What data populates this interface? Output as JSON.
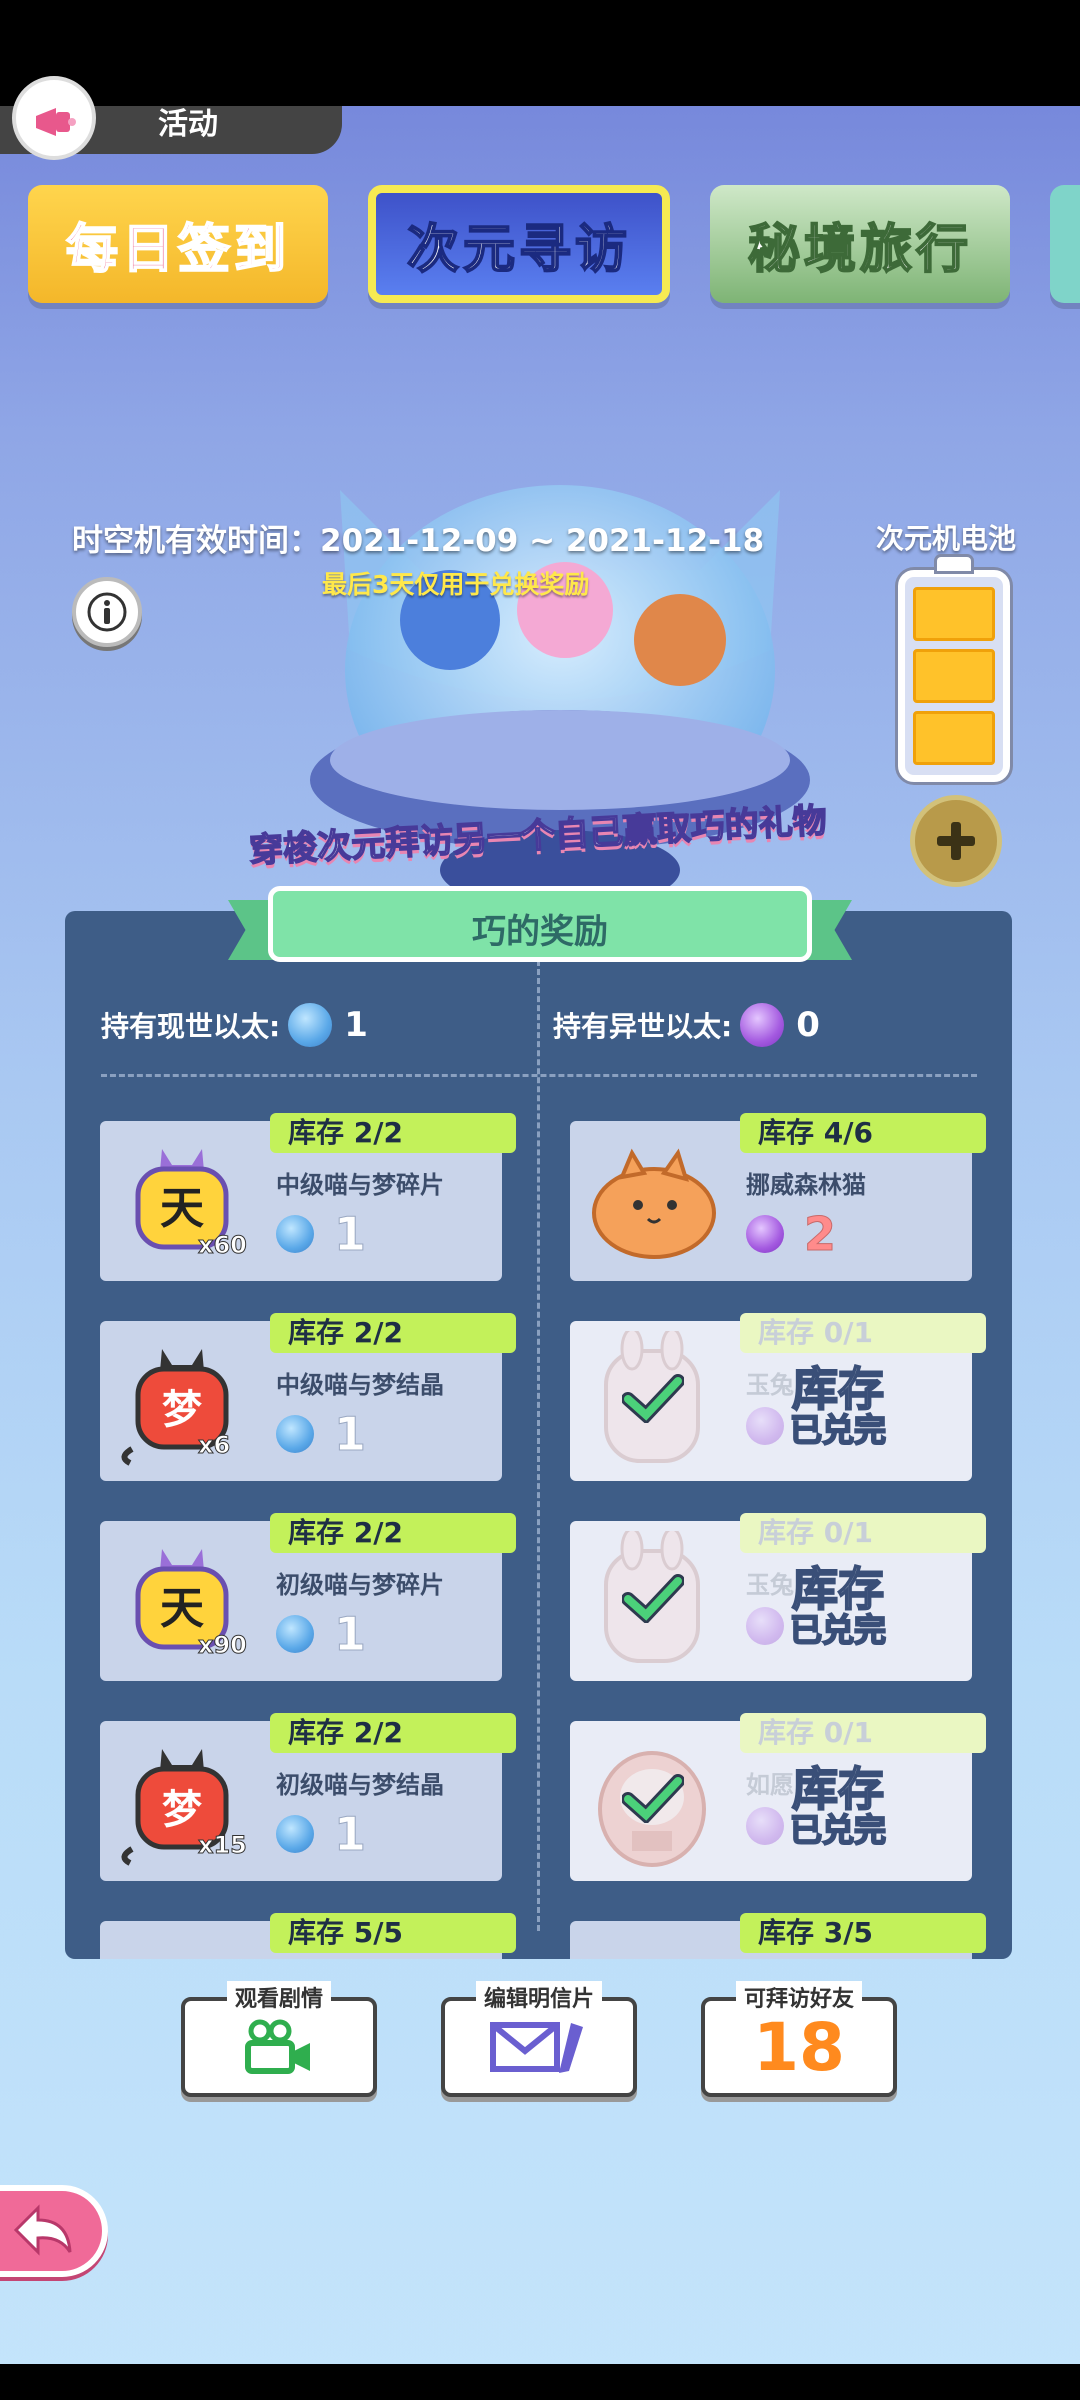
{
  "header": {
    "activity_label": "活动"
  },
  "event_cards": [
    {
      "label": "每日签到"
    },
    {
      "label": "次元寻访"
    },
    {
      "label": "秘境旅行"
    }
  ],
  "machine": {
    "valid_time": "时空机有效时间：2021-12-09 ~ 2021-12-18",
    "note": "最后3天仅用于兑换奖励",
    "battery_label": "次元机电池",
    "battery_cells_filled": 3,
    "battery_cells_total": 3
  },
  "slogan": "穿梭次元拜访另一个自己赢取巧的礼物",
  "panel": {
    "title": "巧的奖励",
    "left_currency_label": "持有现世以太:",
    "left_currency_count": "1",
    "right_currency_label": "持有异世以太:",
    "right_currency_count": "0",
    "left_items": [
      {
        "stock": "库存 2/2",
        "name": "中级喵与梦碎片",
        "qty": "x60",
        "price": "1",
        "icon": "yellow-cat-shirt-icon"
      },
      {
        "stock": "库存 2/2",
        "name": "中级喵与梦结晶",
        "qty": "x6",
        "price": "1",
        "icon": "red-cat-shirt-icon"
      },
      {
        "stock": "库存 2/2",
        "name": "初级喵与梦碎片",
        "qty": "x90",
        "price": "1",
        "icon": "yellow-cat-shirt-icon"
      },
      {
        "stock": "库存 2/2",
        "name": "初级喵与梦结晶",
        "qty": "x15",
        "price": "1",
        "icon": "red-cat-shirt-icon"
      },
      {
        "stock": "库存 5/5"
      }
    ],
    "right_items": [
      {
        "stock": "库存 4/6",
        "name": "挪威森林猫",
        "price": "2",
        "icon": "orange-cat-icon"
      },
      {
        "stock": "库存 0/1",
        "name": "玉兔",
        "price": "",
        "soldout_big": "库存",
        "soldout_small": "已兑完",
        "icon": "bunny-backpack-icon"
      },
      {
        "stock": "库存 0/1",
        "name": "玉兔",
        "price": "",
        "soldout_big": "库存",
        "soldout_small": "已兑完",
        "icon": "bunny-backpack-icon"
      },
      {
        "stock": "库存 0/1",
        "name": "如愿",
        "price": "",
        "soldout_big": "库存",
        "soldout_small": "已兑完",
        "icon": "daruma-icon"
      },
      {
        "stock": "库存 3/5"
      }
    ]
  },
  "actions": {
    "story_label": "观看剧情",
    "postcard_label": "编辑明信片",
    "friends_label": "可拜访好友",
    "friends_count": "18"
  },
  "colors": {
    "stock_badge": "#c3f15a",
    "panel_bg": "#3e5d87",
    "ribbon": "#7fe3a8",
    "battery_cell": "#ffc22a"
  }
}
